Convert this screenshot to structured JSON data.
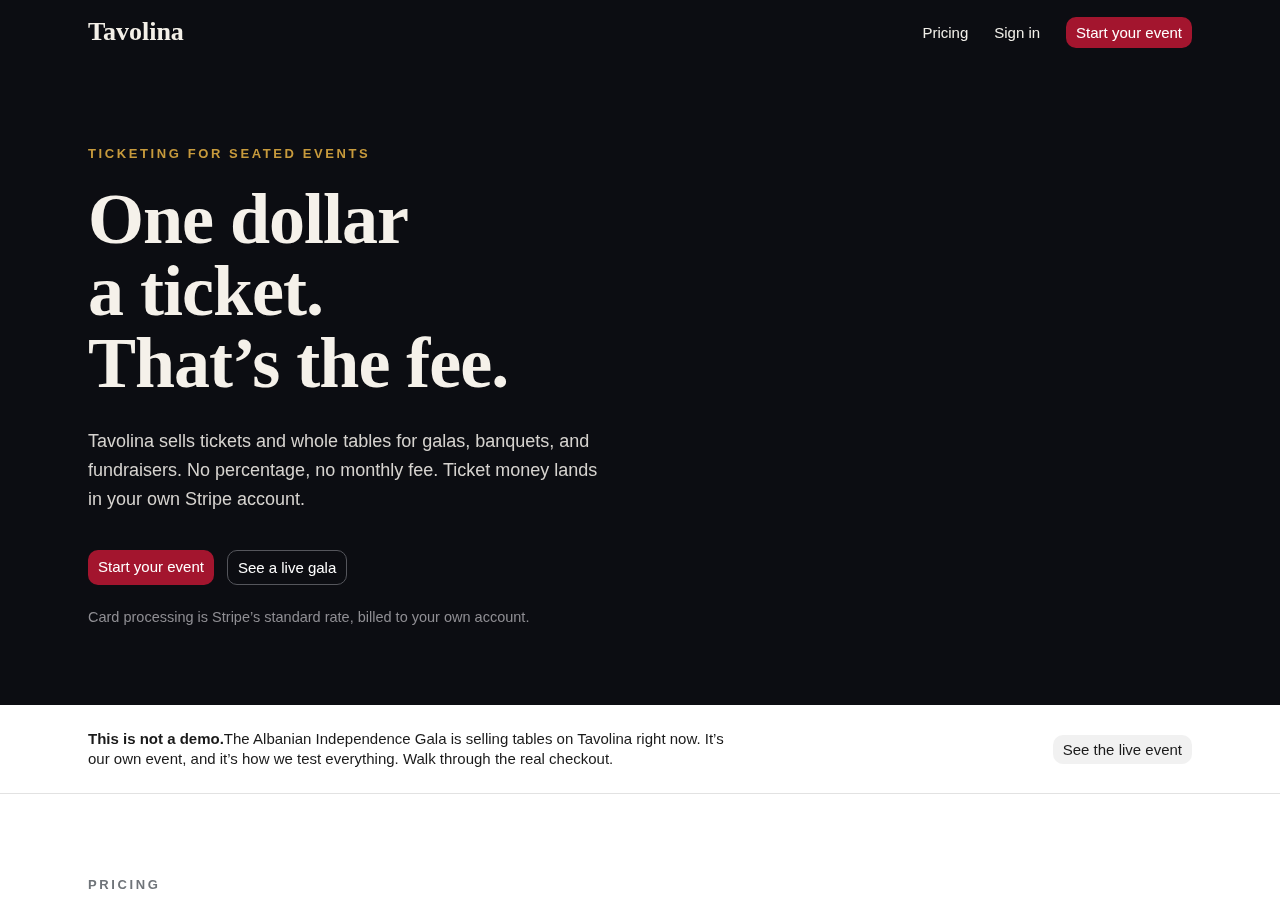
{
  "nav": {
    "logo": "Tavolina",
    "links": [
      {
        "label": "Pricing",
        "kind": "link"
      },
      {
        "label": "Sign in",
        "kind": "link"
      },
      {
        "label": "Start your event",
        "kind": "primary"
      }
    ]
  },
  "hero": {
    "eyebrow": "TICKETING FOR SEATED EVENTS",
    "headline": [
      "One dollar",
      "a ticket.",
      "That’s the fee."
    ],
    "body": "Tavolina sells tickets and whole tables for galas, banquets, and fundraisers. No percentage, no monthly fee. Ticket money lands in your own Stripe account.",
    "buttons": [
      {
        "label": "Start your event",
        "kind": "primary"
      },
      {
        "label": "See a live gala",
        "kind": "outline"
      }
    ],
    "note": "Card processing is Stripe’s standard rate, billed to your own account."
  },
  "banner": {
    "text": "**This is not a demo.**The Albanian Independence Gala is selling tables on Tavolina right now. It’s our own event, and it’s how we test everything. Walk through the real checkout.",
    "button": "See the live event"
  },
  "pricing": {
    "eyebrow": "PRICING"
  }
}
